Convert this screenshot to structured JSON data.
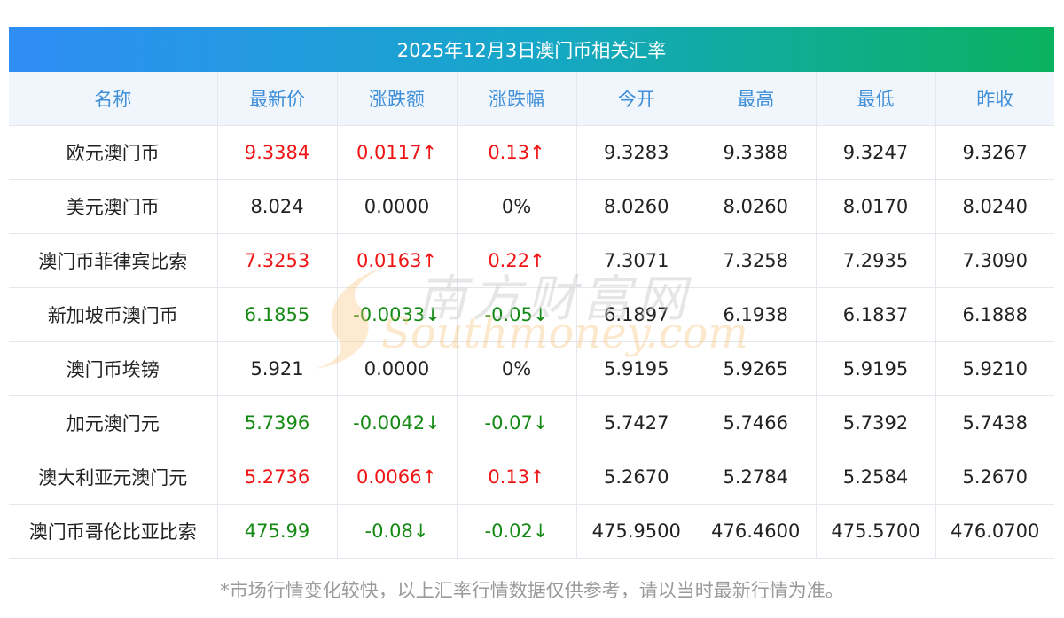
{
  "title": "2025年12月3日澳门币相关汇率",
  "columns": [
    "名称",
    "最新价",
    "涨跌额",
    "涨跌幅",
    "今开",
    "最高",
    "最低",
    "昨收"
  ],
  "rows": [
    {
      "name": "欧元澳门币",
      "latest": "9.3384",
      "change": "0.0117↑",
      "pct": "0.13↑",
      "open": "9.3283",
      "high": "9.3388",
      "low": "9.3247",
      "prev": "9.3267",
      "dir": "up"
    },
    {
      "name": "美元澳门币",
      "latest": "8.024",
      "change": "0.0000",
      "pct": "0%",
      "open": "8.0260",
      "high": "8.0260",
      "low": "8.0170",
      "prev": "8.0240",
      "dir": "flat"
    },
    {
      "name": "澳门币菲律宾比索",
      "latest": "7.3253",
      "change": "0.0163↑",
      "pct": "0.22↑",
      "open": "7.3071",
      "high": "7.3258",
      "low": "7.2935",
      "prev": "7.3090",
      "dir": "up"
    },
    {
      "name": "新加坡币澳门币",
      "latest": "6.1855",
      "change": "-0.0033↓",
      "pct": "-0.05↓",
      "open": "6.1897",
      "high": "6.1938",
      "low": "6.1837",
      "prev": "6.1888",
      "dir": "down"
    },
    {
      "name": "澳门币埃镑",
      "latest": "5.921",
      "change": "0.0000",
      "pct": "0%",
      "open": "5.9195",
      "high": "5.9265",
      "low": "5.9195",
      "prev": "5.9210",
      "dir": "flat"
    },
    {
      "name": "加元澳门元",
      "latest": "5.7396",
      "change": "-0.0042↓",
      "pct": "-0.07↓",
      "open": "5.7427",
      "high": "5.7466",
      "low": "5.7392",
      "prev": "5.7438",
      "dir": "down"
    },
    {
      "name": "澳大利亚元澳门元",
      "latest": "5.2736",
      "change": "0.0066↑",
      "pct": "0.13↑",
      "open": "5.2670",
      "high": "5.2784",
      "low": "5.2584",
      "prev": "5.2670",
      "dir": "up"
    },
    {
      "name": "澳门币哥伦比亚比索",
      "latest": "475.99",
      "change": "-0.08↓",
      "pct": "-0.02↓",
      "open": "475.9500",
      "high": "476.4600",
      "low": "475.5700",
      "prev": "476.0700",
      "dir": "down"
    }
  ],
  "footnote": "*市场行情变化较快，以上汇率行情数据仅供参考，请以当时最新行情为准。",
  "watermark": {
    "cn": "南方财富网",
    "en": "Southmoney.com"
  },
  "colors": {
    "up": "#f01414",
    "down": "#148a14",
    "header_text": "#3f8fd9",
    "header_bg": "#f1f6fc"
  }
}
